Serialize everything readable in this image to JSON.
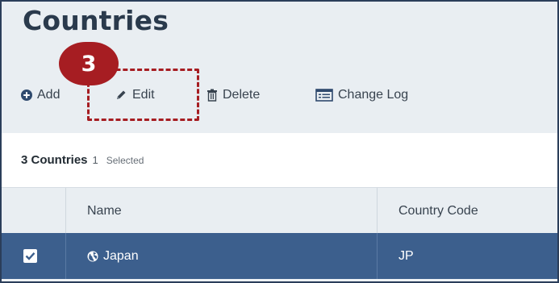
{
  "page": {
    "title": "Countries"
  },
  "toolbar": {
    "add_label": "Add",
    "edit_label": "Edit",
    "delete_label": "Delete",
    "changelog_label": "Change Log"
  },
  "step_badge": "3",
  "summary": {
    "count_label": "3 Countries",
    "selected_count": "1",
    "selected_label": "Selected"
  },
  "table": {
    "headers": [
      "Name",
      "Country Code"
    ],
    "rows": [
      {
        "name": "Japan",
        "code": "JP",
        "selected": true
      }
    ]
  },
  "icons": {
    "add": "plus-circle-icon",
    "edit": "pencil-icon",
    "delete": "trash-icon",
    "changelog": "list-icon",
    "row": "globe-icon",
    "checkbox": "checkmark-icon"
  },
  "colors": {
    "accent_red": "#a61d22",
    "selected_row": "#3c5f8d",
    "band": "#e9eef2",
    "title_text": "#2a3a4c"
  }
}
